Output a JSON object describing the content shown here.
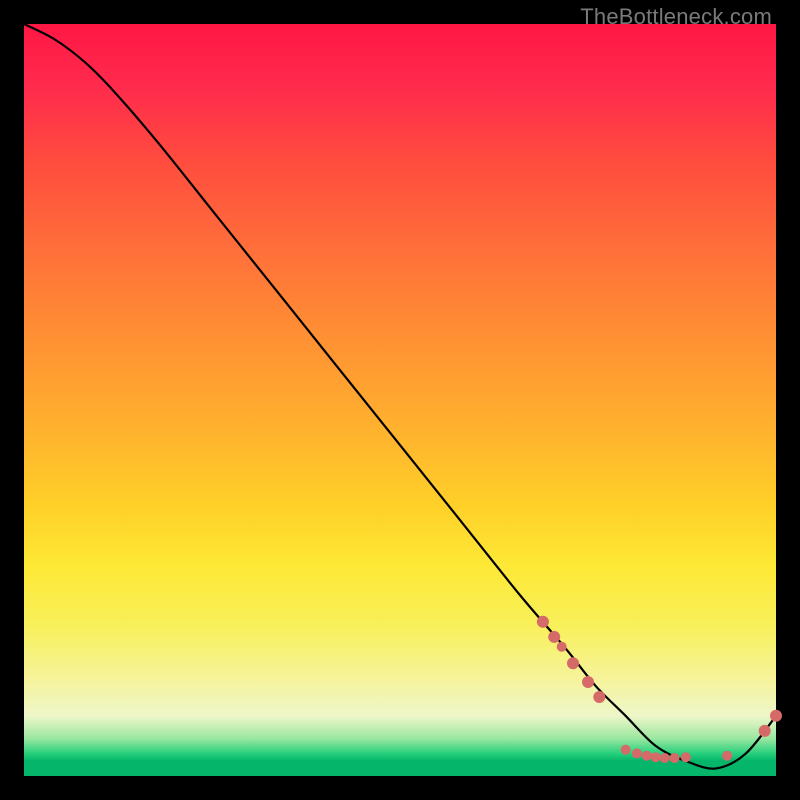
{
  "watermark": "TheBottleneck.com",
  "chart_data": {
    "type": "line",
    "title": "",
    "xlabel": "",
    "ylabel": "",
    "xlim": [
      0,
      100
    ],
    "ylim": [
      0,
      100
    ],
    "series": [
      {
        "name": "bottleneck-curve",
        "x": [
          0,
          4,
          8,
          12,
          18,
          26,
          34,
          42,
          50,
          58,
          66,
          72,
          76,
          80,
          84,
          88,
          92,
          96,
          100
        ],
        "values": [
          100,
          98,
          95,
          91,
          84,
          74,
          64,
          54,
          44,
          34,
          24,
          17,
          12,
          8,
          4,
          2,
          1,
          3,
          8
        ]
      }
    ],
    "markers": {
      "name": "highlight-dots",
      "color": "#d66a68",
      "points": [
        {
          "x": 69.0,
          "y": 20.5,
          "r": 6
        },
        {
          "x": 70.5,
          "y": 18.5,
          "r": 6
        },
        {
          "x": 71.5,
          "y": 17.2,
          "r": 5
        },
        {
          "x": 73.0,
          "y": 15.0,
          "r": 6
        },
        {
          "x": 75.0,
          "y": 12.5,
          "r": 6
        },
        {
          "x": 76.5,
          "y": 10.5,
          "r": 6
        },
        {
          "x": 80.0,
          "y": 3.5,
          "r": 5
        },
        {
          "x": 81.5,
          "y": 3.0,
          "r": 5
        },
        {
          "x": 82.8,
          "y": 2.7,
          "r": 5
        },
        {
          "x": 84.0,
          "y": 2.5,
          "r": 5
        },
        {
          "x": 85.2,
          "y": 2.4,
          "r": 5
        },
        {
          "x": 86.5,
          "y": 2.4,
          "r": 5
        },
        {
          "x": 88.0,
          "y": 2.5,
          "r": 5
        },
        {
          "x": 93.5,
          "y": 2.7,
          "r": 5
        },
        {
          "x": 98.5,
          "y": 6.0,
          "r": 6
        },
        {
          "x": 100.0,
          "y": 8.0,
          "r": 6
        }
      ]
    }
  }
}
